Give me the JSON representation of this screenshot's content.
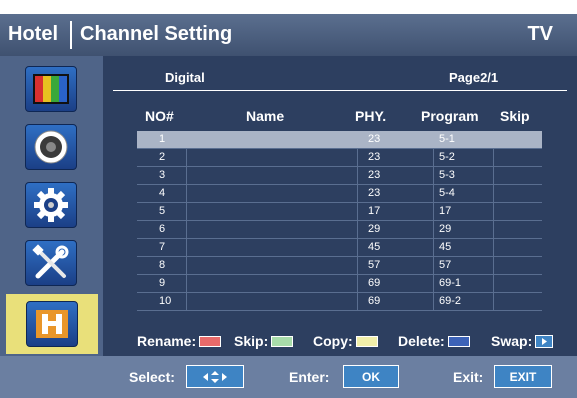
{
  "header": {
    "title_left": "Hotel",
    "title_main": "Channel Setting",
    "source": "TV"
  },
  "sidebar": {
    "items": [
      {
        "icon": "color-bars-icon"
      },
      {
        "icon": "speaker-icon"
      },
      {
        "icon": "gear-icon"
      },
      {
        "icon": "tools-icon"
      },
      {
        "icon": "hotel-h-icon",
        "active": true
      }
    ]
  },
  "main": {
    "mode": "Digital",
    "page": "Page2/1",
    "columns": {
      "no": "NO#",
      "name": "Name",
      "phy": "PHY.",
      "program": "Program",
      "skip": "Skip"
    },
    "rows": [
      {
        "no": "1",
        "name": "",
        "phy": "23",
        "program": "5-1",
        "skip": "",
        "selected": true
      },
      {
        "no": "2",
        "name": "",
        "phy": "23",
        "program": "5-2",
        "skip": ""
      },
      {
        "no": "3",
        "name": "",
        "phy": "23",
        "program": "5-3",
        "skip": ""
      },
      {
        "no": "4",
        "name": "",
        "phy": "23",
        "program": "5-4",
        "skip": ""
      },
      {
        "no": "5",
        "name": "",
        "phy": "17",
        "program": "17",
        "skip": ""
      },
      {
        "no": "6",
        "name": "",
        "phy": "29",
        "program": "29",
        "skip": ""
      },
      {
        "no": "7",
        "name": "",
        "phy": "45",
        "program": "45",
        "skip": ""
      },
      {
        "no": "8",
        "name": "",
        "phy": "57",
        "program": "57",
        "skip": ""
      },
      {
        "no": "9",
        "name": "",
        "phy": "69",
        "program": "69-1",
        "skip": ""
      },
      {
        "no": "10",
        "name": "",
        "phy": "69",
        "program": "69-2",
        "skip": ""
      }
    ]
  },
  "legend": {
    "rename": "Rename:",
    "skip": "Skip:",
    "copy": "Copy:",
    "delete": "Delete:",
    "swap": "Swap:",
    "colors": {
      "red": "#e86a6a",
      "green": "#a8dcaa",
      "yellow": "#f1efaa",
      "blue": "#3d63b8"
    }
  },
  "footer": {
    "select_label": "Select:",
    "select_icon": "arrows-icon",
    "enter_label": "Enter:",
    "enter_button": "OK",
    "exit_label": "Exit:",
    "exit_button": "EXIT"
  }
}
